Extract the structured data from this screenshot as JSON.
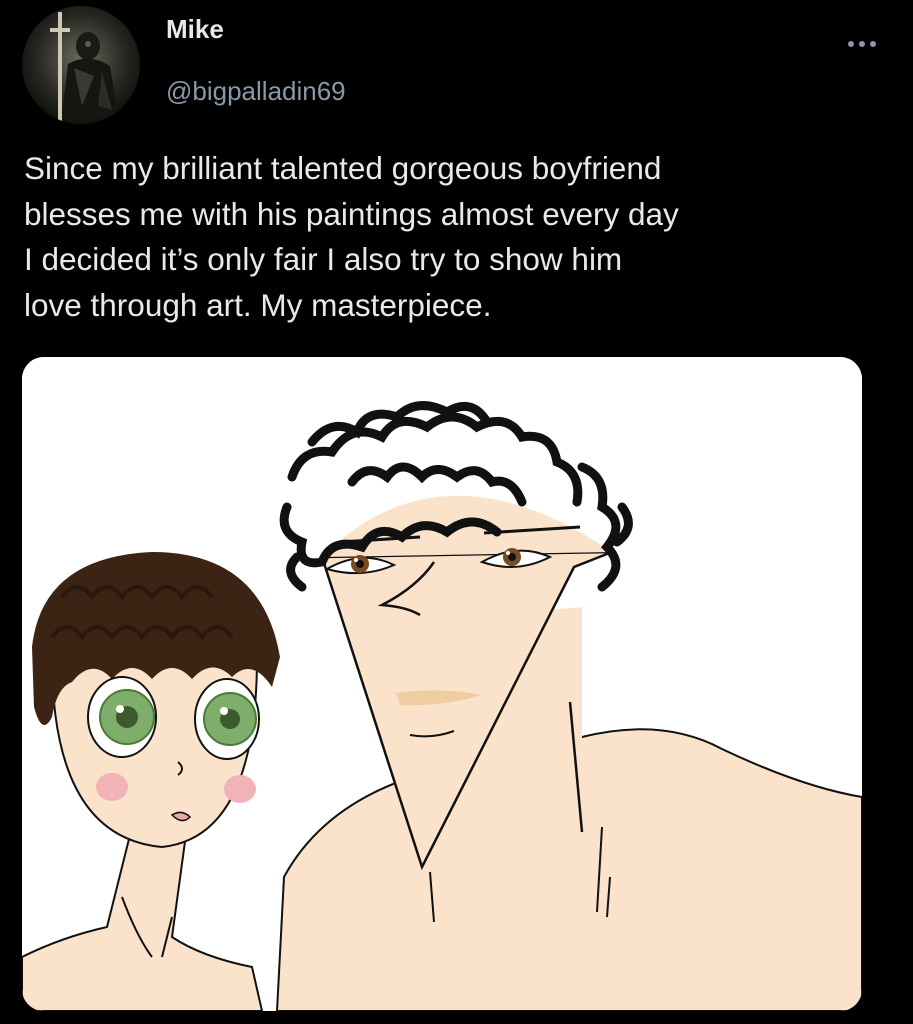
{
  "user": {
    "display_name": "Mike",
    "handle": "@bigpalladin69",
    "avatar_icon": "knight-avatar-icon"
  },
  "more_icon": "more-options-icon",
  "tweet": {
    "lines": [
      "Since my brilliant talented gorgeous boyfriend",
      "blesses me with his paintings almost every day",
      "I decided it’s only fair I also try to show him",
      "love through art. My masterpiece."
    ]
  },
  "media": {
    "type": "drawing",
    "subject": "two-figures-drawing"
  },
  "colors": {
    "background": "#000000",
    "text_primary": "#e7e9ea",
    "text_secondary": "#8b98a5",
    "skin": "#fbe3cb",
    "hair_dark": "#111111",
    "hair_brown": "#3b2414",
    "eye_green": "#7fae6c",
    "eye_brown": "#7a4a22",
    "blush": "#f2b3b8",
    "lips": "#f0cda0"
  }
}
